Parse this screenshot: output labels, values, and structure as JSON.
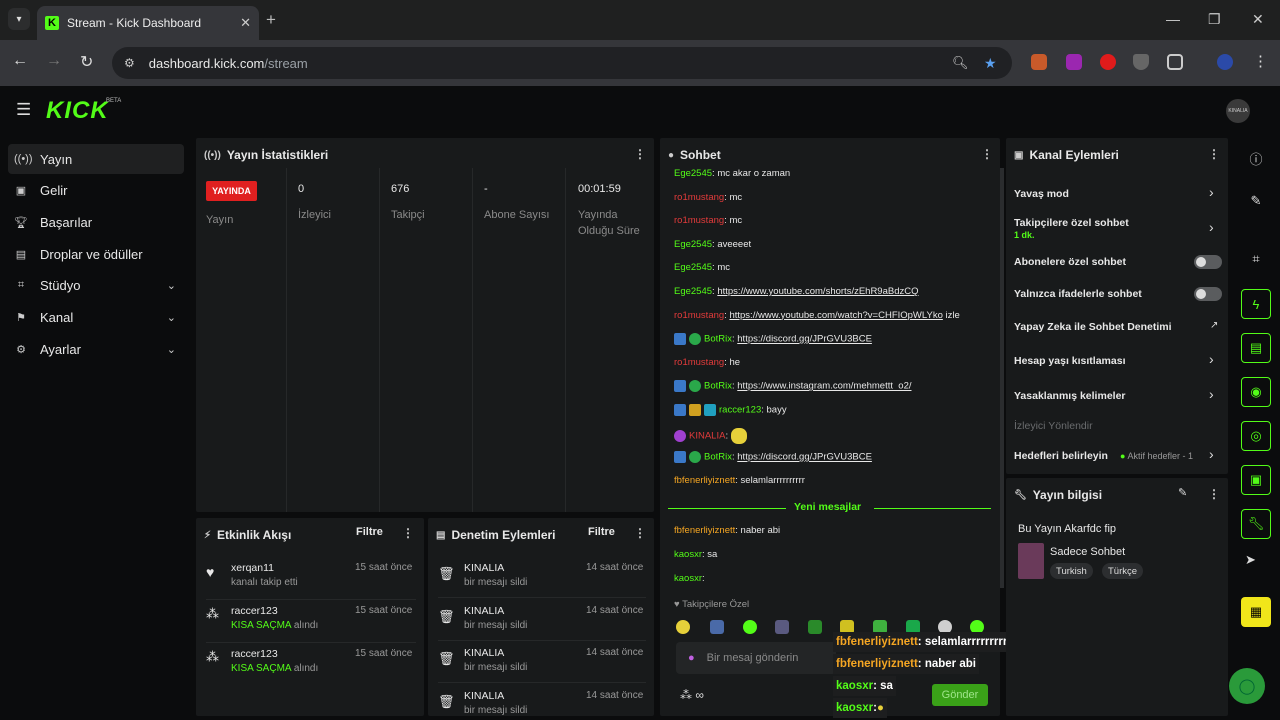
{
  "browser": {
    "tab_title": "Stream - Kick Dashboard",
    "url_host": "dashboard.kick.com",
    "url_path": "/stream"
  },
  "app": {
    "logo": "KICK",
    "beta": "BETA",
    "avatar_text": "KINALIA"
  },
  "sidebar": {
    "items": [
      {
        "label": "Yayın",
        "icon": "broadcast-icon"
      },
      {
        "label": "Gelir",
        "icon": "money-icon"
      },
      {
        "label": "Başarılar",
        "icon": "trophy-icon"
      },
      {
        "label": "Droplar ve ödüller",
        "icon": "gift-icon"
      },
      {
        "label": "Stüdyo",
        "icon": "studio-icon"
      },
      {
        "label": "Kanal",
        "icon": "channel-icon"
      },
      {
        "label": "Ayarlar",
        "icon": "gear-icon"
      }
    ]
  },
  "stats": {
    "title": "Yayın İstatistikleri",
    "live_badge": "YAYINDA",
    "columns": [
      {
        "value": "",
        "label": "Yayın"
      },
      {
        "value": "0",
        "label": "İzleyici"
      },
      {
        "value": "676",
        "label": "Takipçi"
      },
      {
        "value": "-",
        "label": "Abone Sayısı"
      },
      {
        "value": "00:01:59",
        "label": "Yayında Olduğu Süre"
      }
    ]
  },
  "activity": {
    "title": "Etkinlik Akışı",
    "filter": "Filtre",
    "items": [
      {
        "user": "xerqan11",
        "desc": "kanalı takip etti",
        "highlight": "",
        "suffix": "",
        "time": "15 saat önce"
      },
      {
        "user": "raccer123",
        "desc": "",
        "highlight": "KISA SAÇMA",
        "suffix": "alındı",
        "time": "15 saat önce"
      },
      {
        "user": "raccer123",
        "desc": "",
        "highlight": "KISA SAÇMA",
        "suffix": "alındı",
        "time": "15 saat önce"
      }
    ]
  },
  "moderation": {
    "title": "Denetim Eylemleri",
    "filter": "Filtre",
    "items": [
      {
        "user": "KINALIA",
        "desc": "bir mesajı sildi",
        "time": "14 saat önce"
      },
      {
        "user": "KINALIA",
        "desc": "bir mesajı sildi",
        "time": "14 saat önce"
      },
      {
        "user": "KINALIA",
        "desc": "bir mesajı sildi",
        "time": "14 saat önce"
      },
      {
        "user": "KINALIA",
        "desc": "bir mesajı sildi",
        "time": "14 saat önce"
      }
    ]
  },
  "chat": {
    "title": "Sohbet",
    "messages": [
      {
        "user": "Ege2545",
        "color": "g",
        "text": ": mc akar o zaman",
        "link": "",
        "after": ""
      },
      {
        "user": "ro1mustang",
        "color": "r",
        "text": ": mc",
        "link": "",
        "after": ""
      },
      {
        "user": "ro1mustang",
        "color": "r",
        "text": ": mc",
        "link": "",
        "after": ""
      },
      {
        "user": "Ege2545",
        "color": "g",
        "text": ": aveeeet",
        "link": "",
        "after": ""
      },
      {
        "user": "Ege2545",
        "color": "g",
        "text": ": mc",
        "link": "",
        "after": ""
      },
      {
        "user": "Ege2545",
        "color": "g",
        "text": ": ",
        "link": "https://www.youtube.com/shorts/zEhR9aBdzCQ",
        "after": ""
      },
      {
        "user": "ro1mustang",
        "color": "r",
        "text": ": ",
        "link": "https://www.youtube.com/watch?v=CHFIOpWLYko",
        "after": " izle"
      },
      {
        "user": "BotRix",
        "color": "g",
        "text": ": ",
        "link": "https://discord.gg/JPrGVU3BCE",
        "after": ""
      },
      {
        "user": "ro1mustang",
        "color": "r",
        "text": ": he",
        "link": "",
        "after": ""
      },
      {
        "user": "BotRix",
        "color": "g",
        "text": ": ",
        "link": "https://www.instagram.com/mehmettt_o2/",
        "after": ""
      },
      {
        "user": "raccer123",
        "color": "g",
        "text": ": bayy",
        "link": "",
        "after": ""
      },
      {
        "user": "KINALIA",
        "color": "r",
        "text": ": ",
        "link": "",
        "after": ""
      },
      {
        "user": "BotRix",
        "color": "g",
        "text": ": ",
        "link": "https://discord.gg/JPrGVU3BCE",
        "after": ""
      },
      {
        "user": "fbfenerliyiznett",
        "color": "o",
        "text": ": selamlarrrrrrrrrr",
        "link": "",
        "after": ""
      }
    ],
    "new_messages": "Yeni mesajlar",
    "new": [
      {
        "user": "fbfenerliyiznett",
        "color": "o",
        "text": ": naber abi"
      },
      {
        "user": "kaosxr",
        "color": "g",
        "text": ": sa"
      },
      {
        "user": "kaosxr",
        "color": "g",
        "text": ":"
      }
    ],
    "followers_only": "Takipçilere Özel",
    "input_placeholder": "Bir mesaj gönderin",
    "send": "Gönder"
  },
  "overlay": [
    {
      "user": "fbfenerliyiznett",
      "text": " : selamlarrrrrrrrrr"
    },
    {
      "user": "fbfenerliyiznett",
      "text": " : naber abi"
    },
    {
      "user": "kaosxr",
      "text": " : sa"
    },
    {
      "user": "kaosxr",
      "text": " :"
    }
  ],
  "channel_actions": {
    "title": "Kanal Eylemleri",
    "slow_mode": "Yavaş mod",
    "followers_chat": "Takipçilere özel sohbet",
    "followers_chat_sub": "1 dk.",
    "subs_chat": "Abonelere özel sohbet",
    "emotes_chat": "Yalnızca ifadelerle sohbet",
    "ai_mod": "Yapay Zeka ile Sohbet Denetimi",
    "age_limits": "Hesap yaşı kısıtlaması",
    "banned_words": "Yasaklanmış kelimeler",
    "viewer_redirect": "İzleyici Yönlendir",
    "goals": "Hedefleri belirleyin",
    "goals_status": "Aktif hedefler - 1"
  },
  "stream_info": {
    "title": "Yayın bilgisi",
    "stream_title": "Bu Yayın Akarfdc fip",
    "category": "Sadece Sohbet",
    "tags": [
      "Turkish",
      "Türkçe"
    ]
  },
  "colors": {
    "accent": "#53fc18",
    "live": "#e02020",
    "panel": "#181a1b"
  }
}
